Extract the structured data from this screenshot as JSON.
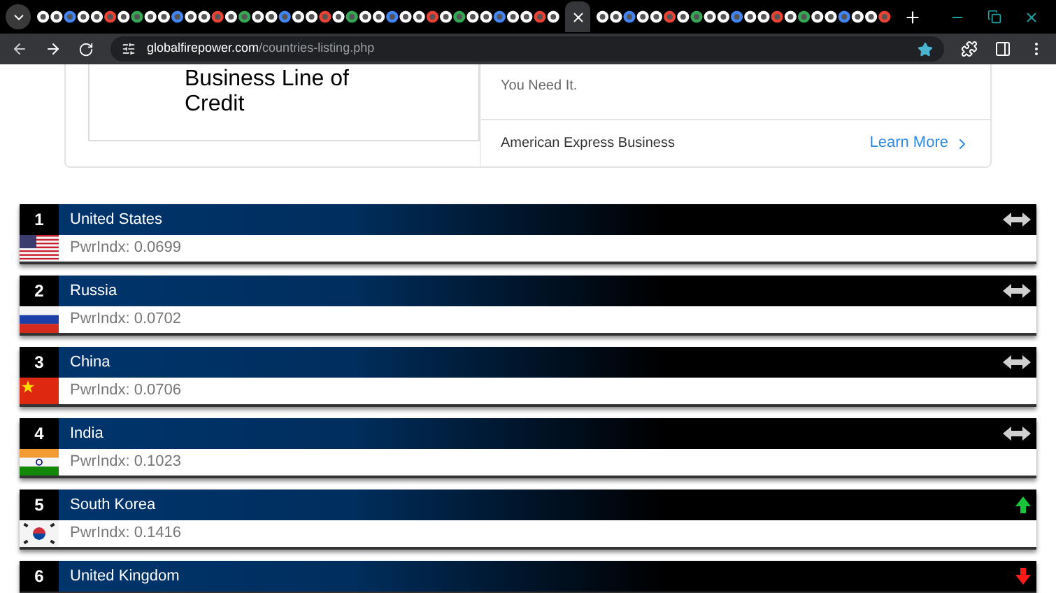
{
  "browser": {
    "url_host": "globalfirepower.com",
    "url_path": "/countries-listing.php",
    "bookmarked": true
  },
  "ad": {
    "title_lines": [
      "Business Line of",
      "Credit"
    ],
    "tagline": "You Need It.",
    "advertiser": "American Express Business",
    "cta": "Learn More"
  },
  "rankings": [
    {
      "rank": "1",
      "country": "United States",
      "power_index": "PwrIndx: 0.0699",
      "flag": {
        "kind": "us"
      },
      "trend": {
        "kind": "same"
      }
    },
    {
      "rank": "2",
      "country": "Russia",
      "power_index": "PwrIndx: 0.0702",
      "flag": {
        "kind": "ru"
      },
      "trend": {
        "kind": "same"
      }
    },
    {
      "rank": "3",
      "country": "China",
      "power_index": "PwrIndx: 0.0706",
      "flag": {
        "kind": "cn"
      },
      "trend": {
        "kind": "same"
      }
    },
    {
      "rank": "4",
      "country": "India",
      "power_index": "PwrIndx: 0.1023",
      "flag": {
        "kind": "in"
      },
      "trend": {
        "kind": "same"
      }
    },
    {
      "rank": "5",
      "country": "South Korea",
      "power_index": "PwrIndx: 0.1416",
      "flag": {
        "kind": "kr"
      },
      "trend": {
        "kind": "up"
      }
    },
    {
      "rank": "6",
      "country": "United Kingdom",
      "trend": {
        "kind": "down"
      }
    }
  ]
}
